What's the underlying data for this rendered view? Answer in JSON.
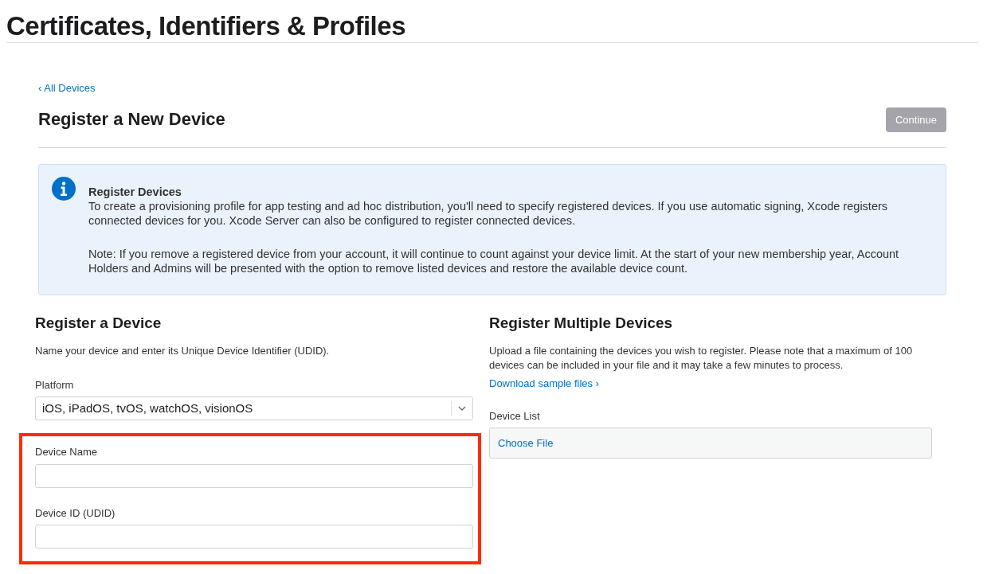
{
  "page_title": "Certificates, Identifiers & Profiles",
  "back_link": "‹ All Devices",
  "heading": "Register a New Device",
  "continue_button": {
    "label": "Continue",
    "disabled": true
  },
  "info": {
    "title": "Register Devices",
    "paragraphs": [
      "To create a provisioning profile for app testing and ad hoc distribution, you'll need to specify registered devices. If you use automatic signing, Xcode registers connected devices for you. Xcode Server can also be configured to register connected devices.",
      "Note: If you remove a registered device from your account, it will continue to count against your device limit. At the start of your new membership year, Account Holders and Admins will be presented with the option to remove listed devices and restore the available device count."
    ]
  },
  "register_device": {
    "title": "Register a Device",
    "description": "Name your device and enter its Unique Device Identifier (UDID).",
    "platform": {
      "label": "Platform",
      "value": "iOS, iPadOS, tvOS, watchOS, visionOS"
    },
    "highlighted": true,
    "fields": [
      {
        "label": "Device Name"
      },
      {
        "label": "Device ID (UDID)"
      }
    ]
  },
  "register_multiple": {
    "title": "Register Multiple Devices",
    "description": "Upload a file containing the devices you wish to register. Please note that a maximum of 100 devices can be included in your file and it may take a few minutes to process.",
    "link": "Download sample files ›",
    "file_label": "Device List",
    "file_button": "Choose File"
  }
}
